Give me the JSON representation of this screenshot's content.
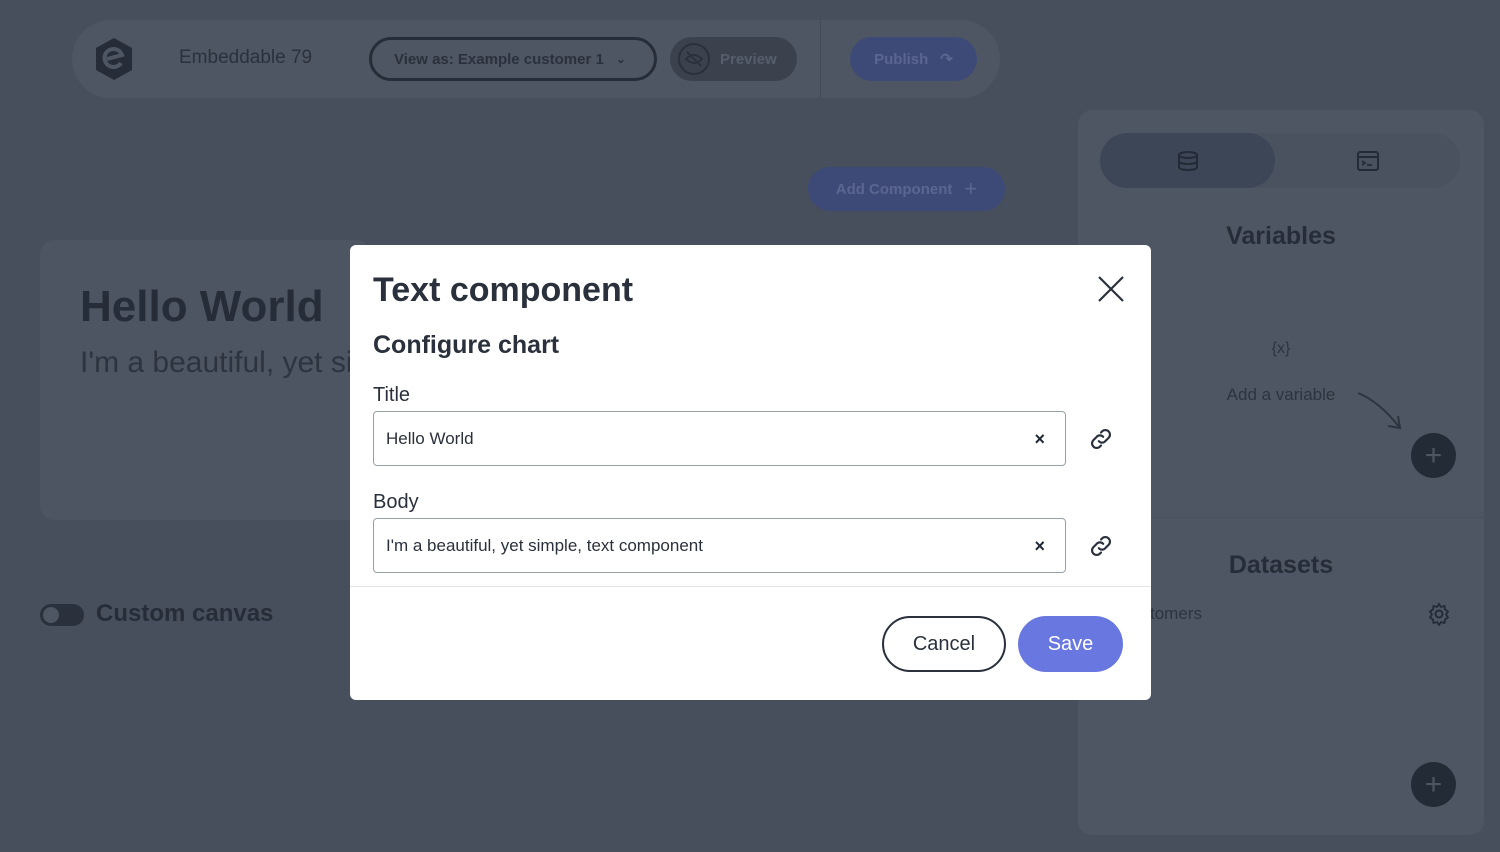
{
  "toolbar": {
    "app_name": "Embeddable 79",
    "view_as": "View as: Example customer 1",
    "preview": "Preview",
    "publish": "Publish"
  },
  "canvas": {
    "add_component": "Add Component",
    "card_title": "Hello World",
    "card_body": "I'm a beautiful, yet simple, text component",
    "custom_canvas": "Custom canvas"
  },
  "panel": {
    "variables_title": "Variables",
    "variable_icon": "{x}",
    "add_variable": "Add a variable",
    "datasets_title": "Datasets",
    "dataset_item": "tomers"
  },
  "modal": {
    "title": "Text component",
    "subtitle": "Configure chart",
    "fields": [
      {
        "label": "Title",
        "value": "Hello World"
      },
      {
        "label": "Body",
        "value": "I'm a beautiful, yet simple, text component"
      }
    ],
    "clear_glyph": "×",
    "cancel": "Cancel",
    "save": "Save"
  },
  "colors": {
    "accent": "#6878e0",
    "overlay": "#474f5c"
  }
}
